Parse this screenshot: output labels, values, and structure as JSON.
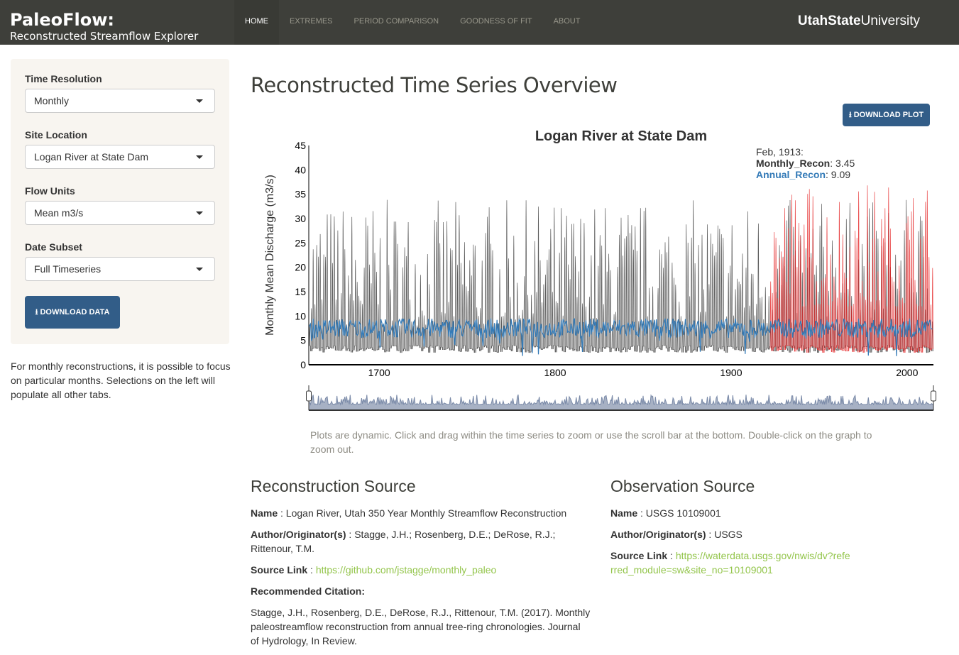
{
  "nav": {
    "title": "PaleoFlow:",
    "subtitle": "Reconstructed Streamflow Explorer",
    "tabs": [
      "HOME",
      "EXTREMES",
      "PERIOD COMPARISON",
      "GOODNESS OF FIT",
      "ABOUT"
    ],
    "active_tab": "HOME",
    "university_bold": "Utah",
    "university_state": "State",
    "university_rest": "University"
  },
  "sidebar": {
    "fields": [
      {
        "label": "Time Resolution",
        "value": "Monthly"
      },
      {
        "label": "Site Location",
        "value": "Logan River at State Dam"
      },
      {
        "label": "Flow Units",
        "value": "Mean m3/s"
      },
      {
        "label": "Date Subset",
        "value": "Full Timeseries"
      }
    ],
    "download_label": "DOWNLOAD DATA",
    "note": "For monthly reconstructions, it is possible to focus on particular months. Selections on the left will populate all other tabs."
  },
  "main": {
    "title": "Reconstructed Time Series Overview",
    "download_plot_label": "DOWNLOAD PLOT",
    "help": "Plots are dynamic. Click and drag within the time series to zoom or use the scroll bar at the bottom. Double-click on the graph to zoom out."
  },
  "tooltip": {
    "date": "Feb, 1913:",
    "s1": "Monthly_Recon",
    "v1": ": 3.45",
    "s2": "Annual_Recon",
    "v2": ": 9.09"
  },
  "chart_data": {
    "type": "line",
    "title": "Logan River at State Dam",
    "ylabel": "Monthly Mean Discharge (m3/s)",
    "xlabel": "",
    "xlim": [
      1660,
      2015
    ],
    "ylim": [
      0,
      45
    ],
    "yticks": [
      "0",
      "5",
      "10",
      "15",
      "20",
      "25",
      "30",
      "35",
      "40",
      "45"
    ],
    "xticks": [
      "1700",
      "1800",
      "1900",
      "2000"
    ],
    "series": [
      {
        "name": "Monthly_Recon",
        "color": "#333333",
        "range": [
          1660,
          2015
        ]
      },
      {
        "name": "Annual_Recon",
        "color": "#337ab7",
        "range": [
          1660,
          2015
        ]
      },
      {
        "color": "#e41a1c",
        "range": [
          1922,
          2015
        ]
      }
    ],
    "range_selector": true,
    "grid": false
  },
  "reconstruction": {
    "heading": "Reconstruction Source",
    "name_label": "Name",
    "name": " : Logan River, Utah 350 Year Monthly Streamflow Reconstruction",
    "author_label": "Author/Originator(s)",
    "author": " : Stagge, J.H.; Rosenberg, D.E.; DeRose, R.J.; Rittenour, T.M.",
    "link_label": "Source Link",
    "link": "https://github.com/jstagge/monthly_paleo",
    "citation_label": "Recommended Citation:",
    "citation": "Stagge, J.H., Rosenberg, D.E., DeRose, R.J., Rittenour, T.M. (2017). Monthly paleostreamflow reconstruction from annual tree-ring chronologies. Journal of Hydrology, In Review."
  },
  "observation": {
    "heading": "Observation Source",
    "name_label": "Name",
    "name": " : USGS 10109001",
    "author_label": "Author/Originator(s)",
    "author": " : USGS",
    "link_label": "Source Link",
    "link": "https://waterdata.usgs.gov/nwis/dv?referred_module=sw&site_no=10109001"
  }
}
